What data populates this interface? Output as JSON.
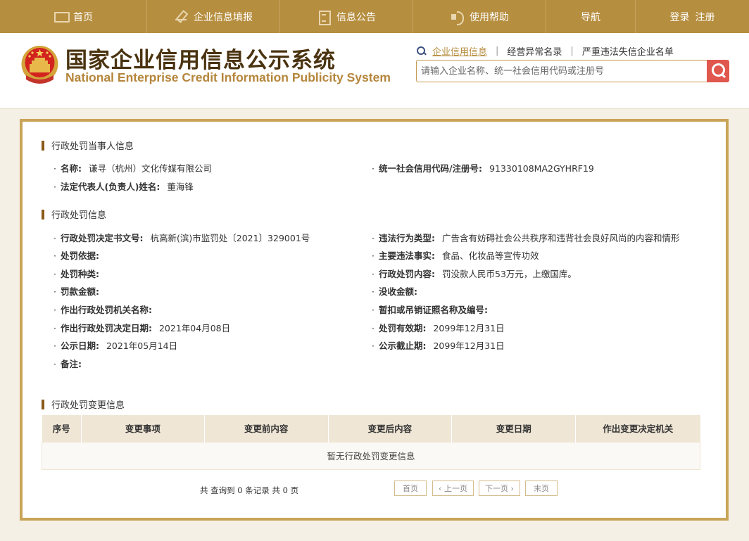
{
  "nav": {
    "home": "首页",
    "fill": "企业信息填报",
    "notice": "信息公告",
    "help": "使用帮助",
    "guide": "导航",
    "login": "登录",
    "register": "注册"
  },
  "header": {
    "title": "国家企业信用信息公示系统",
    "subtitle": "National Enterprise Credit Information Publicity System",
    "links": {
      "credit": "企业信用信息",
      "abnormal": "经营异常名录",
      "serious": "严重违法失信企业名单"
    },
    "search_placeholder": "请输入企业名称、统一社会信用代码或注册号"
  },
  "party": {
    "section_title": "行政处罚当事人信息",
    "name_label": "名称:",
    "name_value": "谦寻（杭州）文化传媒有限公司",
    "code_label": "统一社会信用代码/注册号:",
    "code_value": "91330108MA2GYHRF19",
    "rep_label": "法定代表人(负责人)姓名:",
    "rep_value": "董海锋"
  },
  "penalty": {
    "section_title": "行政处罚信息",
    "doc_no_label": "行政处罚决定书文号:",
    "doc_no_value": "杭高新(滨)市监罚处〔2021〕329001号",
    "type_label": "违法行为类型:",
    "type_value": "广告含有妨碍社会公共秩序和违背社会良好风尚的内容和情形",
    "basis_label": "处罚依据:",
    "facts_label": "主要违法事实:",
    "facts_value": "食品、化妆品等宣传功效",
    "kind_label": "处罚种类:",
    "content_label": "行政处罚内容:",
    "content_value": "罚没款人民币53万元，上缴国库。",
    "fine_label": "罚款金额:",
    "confiscate_label": "没收金额:",
    "authority_label": "作出行政处罚机关名称:",
    "license_label": "暂扣或吊销证照名称及编号:",
    "decision_date_label": "作出行政处罚决定日期:",
    "decision_date_value": "2021年04月08日",
    "valid_label": "处罚有效期:",
    "valid_value": "2099年12月31日",
    "publish_label": "公示日期:",
    "publish_value": "2021年05月14日",
    "deadline_label": "公示截止期:",
    "deadline_value": "2099年12月31日",
    "remark_label": "备注:"
  },
  "changes": {
    "section_title": "行政处罚变更信息",
    "columns": [
      "序号",
      "变更事项",
      "变更前内容",
      "变更后内容",
      "变更日期",
      "作出变更决定机关"
    ],
    "empty_text": "暂无行政处罚变更信息",
    "page_info": "共 查询到 0 条记录 共 0 页",
    "first": "首页",
    "prev": "‹ 上一页",
    "next": "下一页 ›",
    "last": "末页"
  },
  "colors": {
    "brand": "#b68e3f",
    "search_button": "#e0574e",
    "panel_border": "#c9a458"
  }
}
